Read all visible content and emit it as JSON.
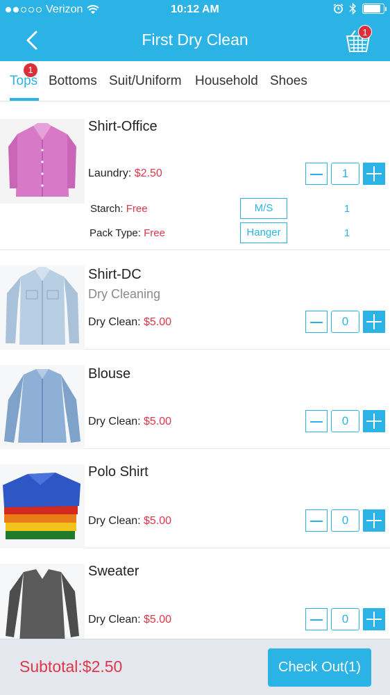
{
  "status_bar": {
    "carrier": "Verizon",
    "time": "10:12 AM",
    "signal_icon": "signal-dots-icon",
    "wifi_icon": "wifi-icon",
    "alarm_icon": "alarm-icon",
    "bluetooth_icon": "bluetooth-icon",
    "battery_level": 0.9
  },
  "header": {
    "title": "First Dry Clean",
    "back_icon": "chevron-left-icon",
    "cart_icon": "basket-icon",
    "cart_count": "1"
  },
  "tabs": [
    {
      "label": "Tops",
      "active": true,
      "badge": "1"
    },
    {
      "label": "Bottoms"
    },
    {
      "label": "Suit/Uniform"
    },
    {
      "label": "Household"
    },
    {
      "label": "Shoes"
    }
  ],
  "items": [
    {
      "name": "Shirt-Office",
      "subtitle": "",
      "price_label": "Laundry:",
      "price": "$2.50",
      "qty": "1",
      "options": [
        {
          "label": "Starch:",
          "value": "Free",
          "choice": "M/S",
          "count": "1"
        },
        {
          "label": "Pack Type:",
          "value": "Free",
          "choice": "Hanger",
          "count": "1"
        }
      ]
    },
    {
      "name": "Shirt-DC",
      "subtitle": "Dry Cleaning",
      "price_label": "Dry Clean:",
      "price": "$5.00",
      "qty": "0"
    },
    {
      "name": "Blouse",
      "subtitle": "",
      "price_label": "Dry Clean:",
      "price": "$5.00",
      "qty": "0"
    },
    {
      "name": "Polo Shirt",
      "subtitle": "",
      "price_label": "Dry Clean:",
      "price": "$5.00",
      "qty": "0"
    },
    {
      "name": "Sweater",
      "subtitle": "",
      "price_label": "Dry Clean:",
      "price": "$5.00",
      "qty": "0"
    }
  ],
  "footer": {
    "subtotal": "Subtotal:$2.50",
    "checkout_label": "Check Out(1)"
  },
  "colors": {
    "accent": "#2bb3e6",
    "price": "#e0364a",
    "badge": "#d9303c"
  }
}
